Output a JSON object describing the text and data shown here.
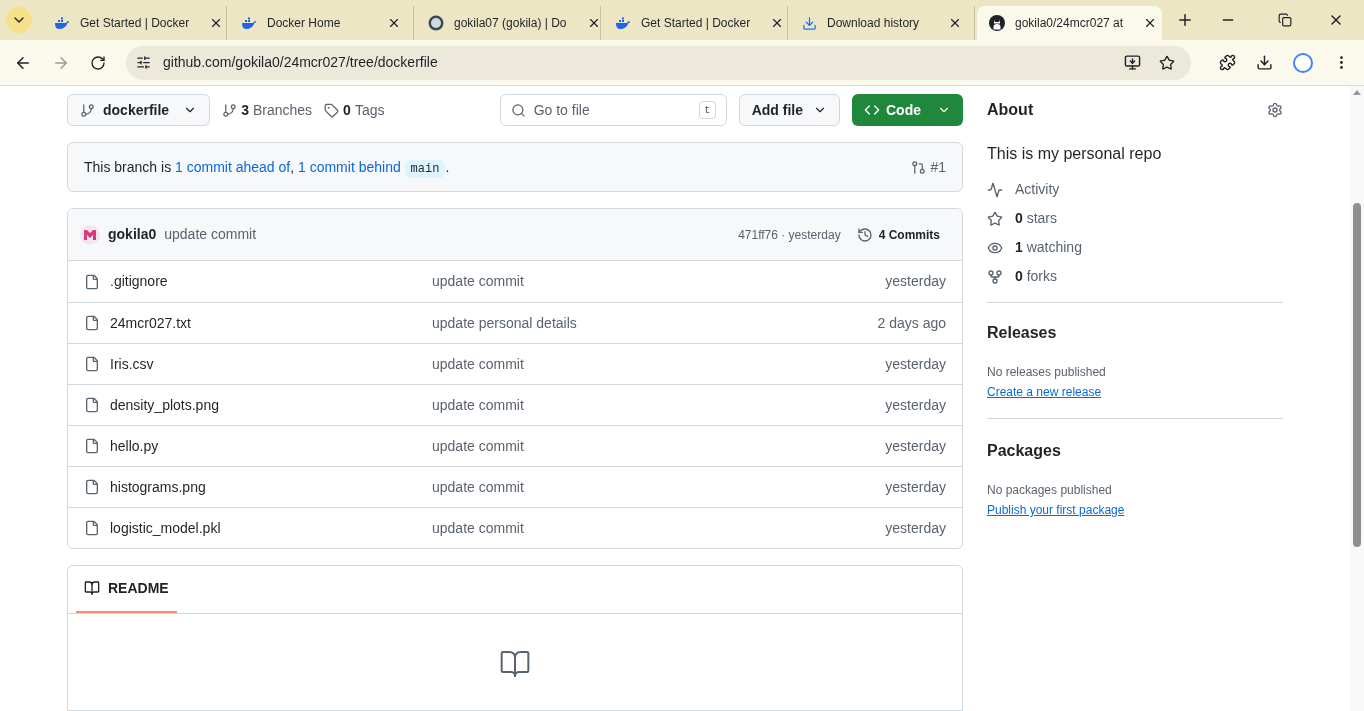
{
  "browser": {
    "tabs": [
      {
        "title": "Get Started | Docker",
        "kind": "docker",
        "selected": false
      },
      {
        "title": "Docker Home",
        "kind": "docker",
        "selected": false
      },
      {
        "title": "gokila07 (gokila) | Do",
        "kind": "avatar",
        "selected": false
      },
      {
        "title": "Get Started | Docker",
        "kind": "docker",
        "selected": false
      },
      {
        "title": "Download history",
        "kind": "download",
        "selected": false
      },
      {
        "title": "gokila0/24mcr027 at",
        "kind": "github",
        "selected": true
      }
    ],
    "url": "github.com/gokila0/24mcr027/tree/dockerfile"
  },
  "repo": {
    "branch": "dockerfile",
    "branches_count": "3",
    "branches_label": "Branches",
    "tags_count": "0",
    "tags_label": "Tags",
    "search": {
      "placeholder": "Go to file",
      "key": "t"
    },
    "add_file": "Add file",
    "code": "Code",
    "branch_status": {
      "prefix": "This branch is ",
      "ahead": "1 commit ahead of",
      "sep": ", ",
      "behind": "1 commit behind",
      "base": "main",
      "suffix": ".",
      "pr": "#1"
    },
    "last_commit": {
      "author": "gokila0",
      "message": "update commit",
      "hash": "471ff76 · yesterday",
      "commits": "4 Commits"
    },
    "files": [
      {
        "name": ".gitignore",
        "message": "update commit",
        "time": "yesterday"
      },
      {
        "name": "24mcr027.txt",
        "message": "update personal details",
        "time": "2 days ago"
      },
      {
        "name": "Iris.csv",
        "message": "update commit",
        "time": "yesterday"
      },
      {
        "name": "density_plots.png",
        "message": "update commit",
        "time": "yesterday"
      },
      {
        "name": "hello.py",
        "message": "update commit",
        "time": "yesterday"
      },
      {
        "name": "histograms.png",
        "message": "update commit",
        "time": "yesterday"
      },
      {
        "name": "logistic_model.pkl",
        "message": "update commit",
        "time": "yesterday"
      }
    ],
    "readme": {
      "tab": "README"
    }
  },
  "about": {
    "title": "About",
    "description": "This is my personal repo",
    "stats": [
      {
        "kind": "activity",
        "label": "Activity"
      },
      {
        "kind": "stars",
        "count": "0",
        "label": "stars"
      },
      {
        "kind": "watching",
        "count": "1",
        "label": "watching"
      },
      {
        "kind": "forks",
        "count": "0",
        "label": "forks"
      }
    ],
    "releases": {
      "title": "Releases",
      "note": "No releases published",
      "link": "Create a new release"
    },
    "packages": {
      "title": "Packages",
      "note": "No packages published",
      "link": "Publish your first package"
    }
  }
}
